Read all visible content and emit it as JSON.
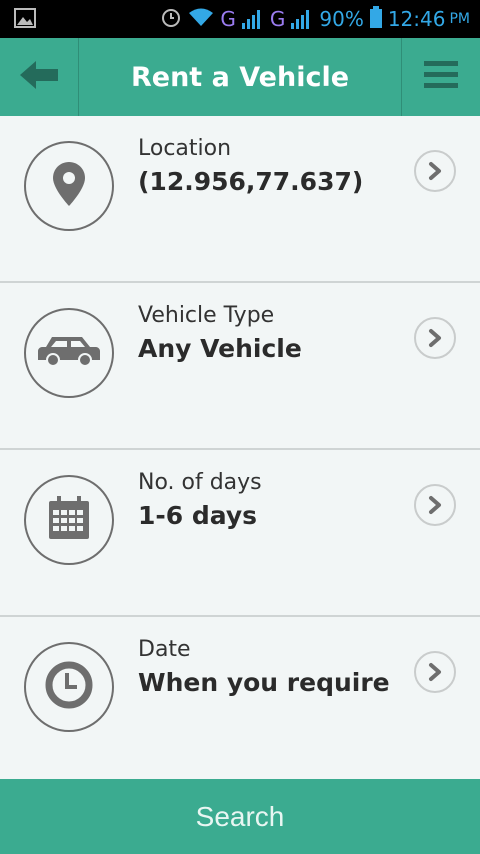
{
  "status_bar": {
    "network_1": "G",
    "network_2": "G",
    "battery": "90%",
    "time": "12:46",
    "ampm": "PM"
  },
  "header": {
    "title": "Rent a Vehicle",
    "back_icon": "arrow-left-icon",
    "menu_icon": "hamburger-menu-icon"
  },
  "rows": [
    {
      "label": "Location",
      "value": "(12.956,77.637)",
      "icon": "map-pin-icon"
    },
    {
      "label": "Vehicle Type",
      "value": "Any Vehicle",
      "icon": "car-icon"
    },
    {
      "label": "No. of days",
      "value": "1-6 days",
      "icon": "calendar-icon"
    },
    {
      "label": "Date",
      "value": "When you require",
      "icon": "clock-icon"
    }
  ],
  "search_button": {
    "label": "Search"
  },
  "colors": {
    "accent": "#3bab90",
    "background": "#f2f6f6",
    "icon_gray": "#6e6e6e"
  }
}
